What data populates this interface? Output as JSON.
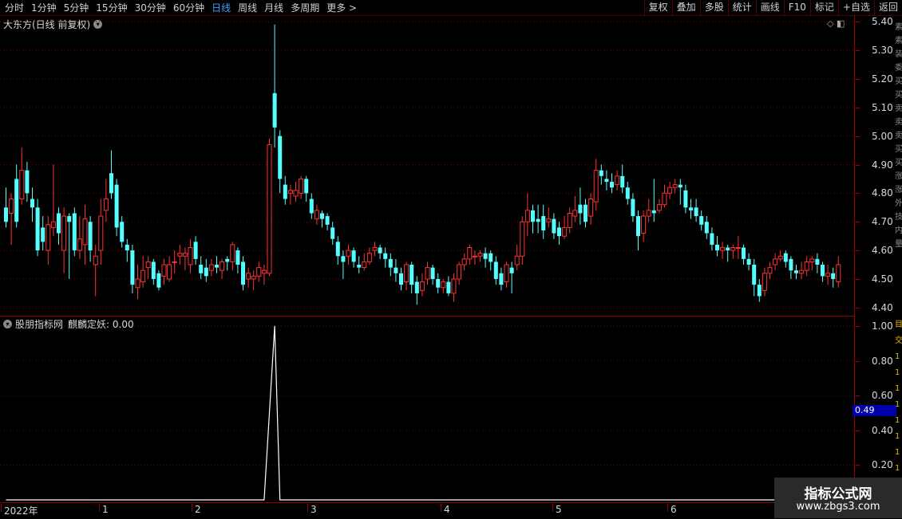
{
  "toolbar": {
    "periods": [
      "分时",
      "1分钟",
      "5分钟",
      "15分钟",
      "30分钟",
      "60分钟",
      "日线",
      "周线",
      "月线",
      "多周期",
      "更多 >"
    ],
    "active": "日线",
    "buttons": [
      "复权",
      "叠加",
      "多股",
      "统计",
      "画线",
      "F10",
      "标记",
      "+自选",
      "返回"
    ]
  },
  "price_panel": {
    "title": "大东方(日线 前复权)",
    "y_labels": [
      "5.40",
      "5.30",
      "5.20",
      "5.10",
      "5.00",
      "4.90",
      "4.80",
      "4.70",
      "4.60",
      "4.50",
      "4.40"
    ]
  },
  "indicator_panel": {
    "source": "股朋指标网",
    "name": "麒麟定妖: 0.00",
    "y_labels": [
      "1.00",
      "0.80",
      "0.60",
      "0.40",
      "0.20"
    ],
    "cursor_value": "0.49"
  },
  "x_axis": [
    "2022年",
    "1",
    "2",
    "3",
    "4",
    "5",
    "6"
  ],
  "watermark": {
    "line1": "指标公式网",
    "line2": "www.zbgs3.com"
  },
  "colors": {
    "up": "#ff3232",
    "down": "#54ffff",
    "grid": "#7a0000",
    "axis": "#9a0000",
    "signal": "#ffffff"
  },
  "chart_data": {
    "type": "candlestick",
    "ylim": [
      4.38,
      5.42
    ],
    "candles": [
      [
        4.75,
        4.7,
        4.82,
        4.68
      ],
      [
        4.73,
        4.78,
        4.8,
        4.62
      ],
      [
        4.85,
        4.7,
        4.9,
        4.68
      ],
      [
        4.78,
        4.88,
        4.96,
        4.76
      ],
      [
        4.88,
        4.8,
        4.91,
        4.77
      ],
      [
        4.78,
        4.75,
        4.82,
        4.7
      ],
      [
        4.75,
        4.6,
        4.78,
        4.58
      ],
      [
        4.68,
        4.63,
        4.72,
        4.6
      ],
      [
        4.6,
        4.69,
        4.72,
        4.55
      ],
      [
        4.68,
        4.7,
        4.9,
        4.65
      ],
      [
        4.73,
        4.66,
        4.75,
        4.62
      ],
      [
        4.6,
        4.72,
        4.75,
        4.52
      ],
      [
        4.72,
        4.7,
        4.73,
        4.5
      ],
      [
        4.73,
        4.6,
        4.75,
        4.58
      ],
      [
        4.6,
        4.64,
        4.72,
        4.57
      ],
      [
        4.62,
        4.71,
        4.76,
        4.55
      ],
      [
        4.7,
        4.6,
        4.72,
        4.56
      ],
      [
        4.55,
        4.58,
        4.62,
        4.44
      ],
      [
        4.6,
        4.72,
        4.78,
        4.55
      ],
      [
        4.74,
        4.78,
        4.85,
        4.7
      ],
      [
        4.87,
        4.8,
        4.95,
        4.78
      ],
      [
        4.83,
        4.68,
        4.85,
        4.65
      ],
      [
        4.7,
        4.63,
        4.72,
        4.61
      ],
      [
        4.62,
        4.6,
        4.64,
        4.56
      ],
      [
        4.6,
        4.48,
        4.62,
        4.45
      ],
      [
        4.47,
        4.5,
        4.55,
        4.43
      ],
      [
        4.49,
        4.53,
        4.58,
        4.47
      ],
      [
        4.54,
        4.56,
        4.58,
        4.5
      ],
      [
        4.56,
        4.5,
        4.57,
        4.48
      ],
      [
        4.52,
        4.47,
        4.53,
        4.46
      ],
      [
        4.51,
        4.55,
        4.57,
        4.48
      ],
      [
        4.5,
        4.55,
        4.58,
        4.49
      ],
      [
        4.56,
        4.56,
        4.6,
        4.52
      ],
      [
        4.58,
        4.59,
        4.62,
        4.55
      ],
      [
        4.58,
        4.59,
        4.61,
        4.53
      ],
      [
        4.55,
        4.61,
        4.64,
        4.52
      ],
      [
        4.63,
        4.57,
        4.65,
        4.55
      ],
      [
        4.55,
        4.52,
        4.58,
        4.5
      ],
      [
        4.54,
        4.51,
        4.57,
        4.49
      ],
      [
        4.53,
        4.55,
        4.57,
        4.51
      ],
      [
        4.55,
        4.54,
        4.58,
        4.52
      ],
      [
        4.53,
        4.56,
        4.57,
        4.5
      ],
      [
        4.57,
        4.56,
        4.58,
        4.53
      ],
      [
        4.56,
        4.62,
        4.63,
        4.53
      ],
      [
        4.6,
        4.55,
        4.61,
        4.52
      ],
      [
        4.56,
        4.48,
        4.58,
        4.46
      ],
      [
        4.5,
        4.52,
        4.54,
        4.47
      ],
      [
        4.5,
        4.51,
        4.53,
        4.46
      ],
      [
        4.51,
        4.54,
        4.56,
        4.49
      ],
      [
        4.52,
        4.53,
        4.55,
        4.48
      ],
      [
        4.52,
        4.97,
        4.99,
        4.51
      ],
      [
        5.15,
        5.03,
        5.39,
        4.96
      ],
      [
        5.0,
        4.85,
        5.02,
        4.8
      ],
      [
        4.83,
        4.78,
        4.86,
        4.76
      ],
      [
        4.8,
        4.81,
        4.83,
        4.76
      ],
      [
        4.79,
        4.81,
        4.84,
        4.77
      ],
      [
        4.8,
        4.85,
        4.86,
        4.78
      ],
      [
        4.85,
        4.8,
        4.86,
        4.77
      ],
      [
        4.78,
        4.73,
        4.8,
        4.71
      ],
      [
        4.71,
        4.74,
        4.76,
        4.69
      ],
      [
        4.73,
        4.71,
        4.74,
        4.68
      ],
      [
        4.72,
        4.69,
        4.73,
        4.67
      ],
      [
        4.68,
        4.64,
        4.7,
        4.62
      ],
      [
        4.63,
        4.58,
        4.65,
        4.55
      ],
      [
        4.58,
        4.56,
        4.6,
        4.5
      ],
      [
        4.58,
        4.6,
        4.62,
        4.55
      ],
      [
        4.6,
        4.56,
        4.61,
        4.54
      ],
      [
        4.55,
        4.54,
        4.58,
        4.52
      ],
      [
        4.54,
        4.56,
        4.59,
        4.53
      ],
      [
        4.56,
        4.59,
        4.61,
        4.55
      ],
      [
        4.6,
        4.61,
        4.63,
        4.58
      ],
      [
        4.61,
        4.59,
        4.62,
        4.57
      ],
      [
        4.59,
        4.57,
        4.61,
        4.54
      ],
      [
        4.57,
        4.54,
        4.59,
        4.51
      ],
      [
        4.54,
        4.52,
        4.57,
        4.49
      ],
      [
        4.52,
        4.48,
        4.54,
        4.46
      ],
      [
        4.49,
        4.55,
        4.56,
        4.46
      ],
      [
        4.55,
        4.48,
        4.56,
        4.45
      ],
      [
        4.49,
        4.45,
        4.51,
        4.41
      ],
      [
        4.46,
        4.49,
        4.52,
        4.44
      ],
      [
        4.5,
        4.54,
        4.56,
        4.48
      ],
      [
        4.54,
        4.5,
        4.55,
        4.48
      ],
      [
        4.5,
        4.47,
        4.52,
        4.45
      ],
      [
        4.47,
        4.49,
        4.5,
        4.45
      ],
      [
        4.49,
        4.45,
        4.51,
        4.44
      ],
      [
        4.45,
        4.5,
        4.52,
        4.42
      ],
      [
        4.5,
        4.55,
        4.56,
        4.48
      ],
      [
        4.55,
        4.57,
        4.59,
        4.53
      ],
      [
        4.57,
        4.61,
        4.62,
        4.55
      ],
      [
        4.58,
        4.58,
        4.6,
        4.55
      ],
      [
        4.58,
        4.59,
        4.6,
        4.56
      ],
      [
        4.59,
        4.57,
        4.61,
        4.54
      ],
      [
        4.59,
        4.56,
        4.6,
        4.53
      ],
      [
        4.56,
        4.5,
        4.58,
        4.48
      ],
      [
        4.52,
        4.48,
        4.54,
        4.46
      ],
      [
        4.49,
        4.55,
        4.56,
        4.47
      ],
      [
        4.54,
        4.52,
        4.56,
        4.45
      ],
      [
        4.55,
        4.58,
        4.62,
        4.53
      ],
      [
        4.58,
        4.7,
        4.72,
        4.55
      ],
      [
        4.7,
        4.74,
        4.8,
        4.65
      ],
      [
        4.74,
        4.7,
        4.76,
        4.66
      ],
      [
        4.71,
        4.7,
        4.76,
        4.66
      ],
      [
        4.72,
        4.67,
        4.76,
        4.64
      ],
      [
        4.7,
        4.71,
        4.75,
        4.68
      ],
      [
        4.71,
        4.66,
        4.73,
        4.64
      ],
      [
        4.68,
        4.65,
        4.7,
        4.62
      ],
      [
        4.65,
        4.68,
        4.72,
        4.64
      ],
      [
        4.68,
        4.73,
        4.75,
        4.66
      ],
      [
        4.72,
        4.74,
        4.79,
        4.7
      ],
      [
        4.76,
        4.73,
        4.82,
        4.69
      ],
      [
        4.76,
        4.7,
        4.78,
        4.68
      ],
      [
        4.72,
        4.78,
        4.8,
        4.69
      ],
      [
        4.77,
        4.88,
        4.92,
        4.74
      ],
      [
        4.88,
        4.86,
        4.9,
        4.83
      ],
      [
        4.85,
        4.84,
        4.88,
        4.81
      ],
      [
        4.84,
        4.82,
        4.87,
        4.8
      ],
      [
        4.83,
        4.86,
        4.88,
        4.81
      ],
      [
        4.86,
        4.82,
        4.9,
        4.8
      ],
      [
        4.82,
        4.78,
        4.84,
        4.76
      ],
      [
        4.78,
        4.72,
        4.8,
        4.7
      ],
      [
        4.72,
        4.65,
        4.74,
        4.6
      ],
      [
        4.66,
        4.72,
        4.74,
        4.63
      ],
      [
        4.72,
        4.74,
        4.78,
        4.7
      ],
      [
        4.74,
        4.73,
        4.85,
        4.7
      ],
      [
        4.74,
        4.76,
        4.78,
        4.73
      ],
      [
        4.76,
        4.8,
        4.83,
        4.75
      ],
      [
        4.8,
        4.82,
        4.84,
        4.78
      ],
      [
        4.82,
        4.83,
        4.85,
        4.8
      ],
      [
        4.83,
        4.82,
        4.85,
        4.76
      ],
      [
        4.81,
        4.75,
        4.83,
        4.73
      ],
      [
        4.75,
        4.74,
        4.78,
        4.71
      ],
      [
        4.75,
        4.72,
        4.78,
        4.7
      ],
      [
        4.72,
        4.69,
        4.74,
        4.67
      ],
      [
        4.7,
        4.66,
        4.72,
        4.64
      ],
      [
        4.66,
        4.62,
        4.68,
        4.6
      ],
      [
        4.62,
        4.6,
        4.65,
        4.58
      ],
      [
        4.6,
        4.61,
        4.63,
        4.57
      ],
      [
        4.61,
        4.6,
        4.62,
        4.56
      ],
      [
        4.6,
        4.61,
        4.62,
        4.57
      ],
      [
        4.61,
        4.61,
        4.65,
        4.57
      ],
      [
        4.61,
        4.57,
        4.62,
        4.55
      ],
      [
        4.57,
        4.55,
        4.59,
        4.53
      ],
      [
        4.55,
        4.48,
        4.57,
        4.44
      ],
      [
        4.48,
        4.44,
        4.5,
        4.42
      ],
      [
        4.46,
        4.52,
        4.54,
        4.44
      ],
      [
        4.52,
        4.54,
        4.56,
        4.5
      ],
      [
        4.55,
        4.57,
        4.59,
        4.53
      ],
      [
        4.57,
        4.58,
        4.6,
        4.56
      ],
      [
        4.59,
        4.56,
        4.6,
        4.54
      ],
      [
        4.57,
        4.53,
        4.58,
        4.5
      ],
      [
        4.53,
        4.52,
        4.55,
        4.5
      ],
      [
        4.52,
        4.53,
        4.56,
        4.5
      ],
      [
        4.53,
        4.56,
        4.58,
        4.51
      ],
      [
        4.56,
        4.57,
        4.58,
        4.53
      ],
      [
        4.57,
        4.55,
        4.59,
        4.52
      ],
      [
        4.55,
        4.51,
        4.56,
        4.49
      ],
      [
        4.51,
        4.52,
        4.55,
        4.48
      ],
      [
        4.52,
        4.5,
        4.54,
        4.47
      ],
      [
        4.49,
        4.55,
        4.58,
        4.47
      ]
    ],
    "signal": {
      "ylim": [
        0,
        1.05
      ],
      "x": [
        0,
        49,
        50,
        51,
        52,
        158
      ],
      "y": [
        0,
        0,
        0.5,
        1.0,
        0,
        0
      ]
    }
  }
}
